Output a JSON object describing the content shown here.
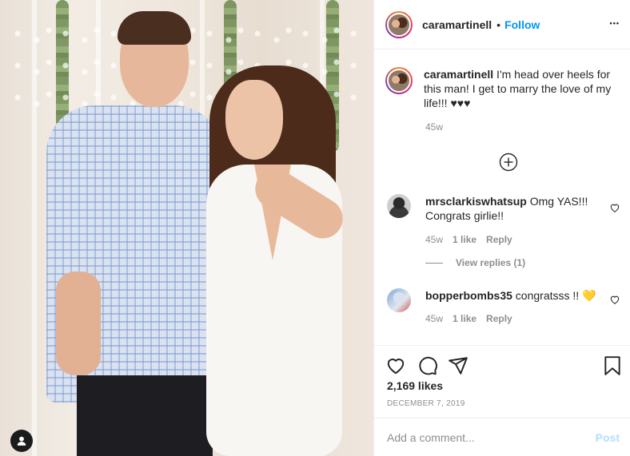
{
  "post": {
    "author": "caramartinell",
    "follow_label": "Follow",
    "separator": "•",
    "more_label": "•••"
  },
  "caption": {
    "username": "caramartinell",
    "text": " I'm head over heels for this man! I get to marry the love of my life!!! ♥♥♥",
    "time": "45w"
  },
  "comments": [
    {
      "username": "mrsclarkiswhatsup",
      "text": " Omg YAS!!! Congrats girlie!!",
      "time": "45w",
      "likes": "1 like",
      "reply_label": "Reply",
      "view_replies": "View replies (1)"
    },
    {
      "username": "bopperbombs35",
      "text": " congratsss !! 💛",
      "time": "45w",
      "likes": "1 like",
      "reply_label": "Reply"
    }
  ],
  "stats": {
    "likes": "2,169 likes",
    "date": "DECEMBER 7, 2019"
  },
  "add_comment": {
    "placeholder": "Add a comment...",
    "post_label": "Post"
  },
  "colors": {
    "accent": "#0095f6",
    "text": "#262626",
    "muted": "#8e8e8e",
    "post_disabled": "#b2dffc"
  },
  "icons": [
    "heart-icon",
    "comment-icon",
    "share-icon",
    "bookmark-icon",
    "plus-circle-icon",
    "user-tag-icon",
    "more-icon"
  ]
}
